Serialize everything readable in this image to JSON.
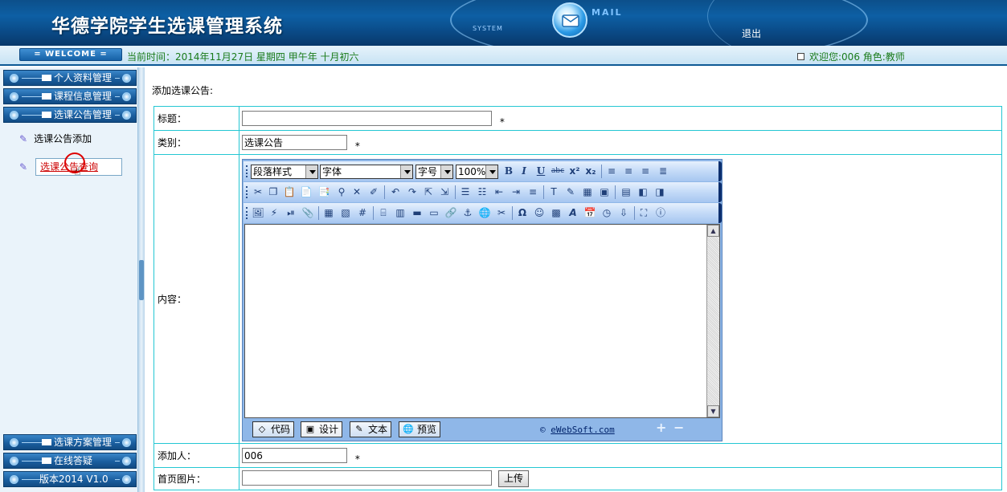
{
  "header": {
    "title": "华德学院学生选课管理系统",
    "system_label": "SYSTEM",
    "mail_label": "MAIL",
    "logout": "退出"
  },
  "infobar": {
    "welcome": "= WELCOME =",
    "current_time": "当前时间：2014年11月27日 星期四 甲午年 十月初六",
    "user_info": "欢迎您:006 角色:教师"
  },
  "sidebar": {
    "menus_top": [
      {
        "label": "个人资料管理"
      },
      {
        "label": "课程信息管理"
      },
      {
        "label": "选课公告管理"
      }
    ],
    "sub_items": [
      {
        "label": "选课公告添加"
      },
      {
        "label": "选课公告查询"
      }
    ],
    "menus_bottom": [
      {
        "label": "选课方案管理"
      },
      {
        "label": "在线答疑"
      },
      {
        "label": "版本2014 V1.0"
      }
    ]
  },
  "main": {
    "heading": "添加选课公告:",
    "form": {
      "title_label": "标题：",
      "title_value": "",
      "category_label": "类别：",
      "category_value": "选课公告",
      "content_label": "内容：",
      "adder_label": "添加人：",
      "adder_value": "006",
      "image_label": "首页图片：",
      "image_value": "",
      "upload_button": "上传",
      "required_mark": "*"
    },
    "editor": {
      "paragraph_style": "段落样式",
      "font": "字体",
      "font_size": "字号",
      "zoom": "100%",
      "modes": [
        {
          "label": "代码"
        },
        {
          "label": "设计"
        },
        {
          "label": "文本"
        },
        {
          "label": "预览"
        }
      ],
      "brand": "eWebSoft.com"
    }
  }
}
